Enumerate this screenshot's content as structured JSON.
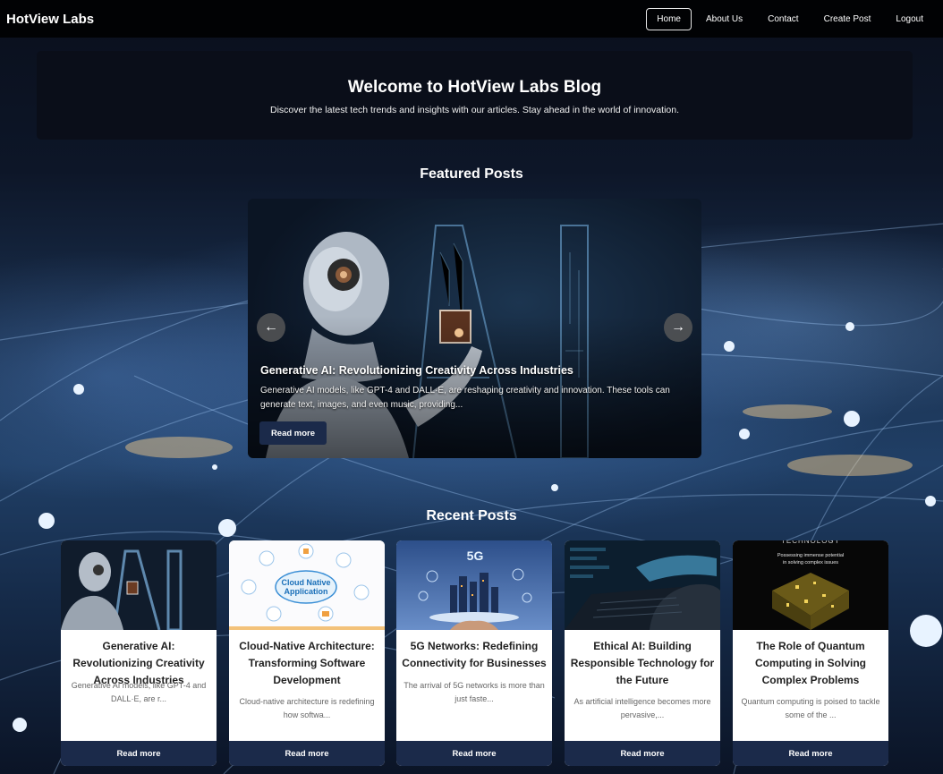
{
  "navbar": {
    "brand": "HotView Labs",
    "links": [
      "Home",
      "About Us",
      "Contact",
      "Create Post",
      "Logout"
    ],
    "active": "Home"
  },
  "hero": {
    "title": "Welcome to HotView Labs Blog",
    "subtitle": "Discover the latest tech trends and insights with our articles. Stay ahead in the world of innovation."
  },
  "featured": {
    "heading": "Featured Posts",
    "slide": {
      "title": "Generative AI: Revolutionizing Creativity Across Industries",
      "excerpt": "Generative AI models, like GPT-4 and DALL·E, are reshaping creativity and innovation. These tools can generate text, images, and even music, providing...",
      "button": "Read more"
    },
    "prev_icon": "←",
    "next_icon": "→"
  },
  "recent": {
    "heading": "Recent Posts",
    "posts": [
      {
        "title": "Generative AI: Revolutionizing Creativity Across Industries",
        "excerpt": "Generative AI models, like GPT-4 and DALL·E, are r...",
        "button": "Read more"
      },
      {
        "title": "Cloud-Native Architecture: Transforming Software Development",
        "excerpt": "Cloud-native architecture is redefining how softwa...",
        "button": "Read more",
        "image_text": "Cloud Native Application"
      },
      {
        "title": "5G Networks: Redefining Connectivity for Businesses",
        "excerpt": "The arrival of 5G networks is more than just faste...",
        "button": "Read more",
        "image_text": "5G"
      },
      {
        "title": "Ethical AI: Building Responsible Technology for the Future",
        "excerpt": "As artificial intelligence becomes more pervasive,...",
        "button": "Read more"
      },
      {
        "title": "The Role of Quantum Computing in Solving Complex Problems",
        "excerpt": "Quantum computing is poised to tackle some of the ...",
        "button": "Read more",
        "image_text": [
          "TECHNOLOGY",
          "Possessing immense potential",
          "in solving complex issues"
        ]
      }
    ]
  },
  "colors": {
    "navbar_bg": "#000000",
    "button_bg": "#1b2a4a",
    "card_bg": "#ffffff",
    "accent_glow": "#9cc8ff"
  }
}
